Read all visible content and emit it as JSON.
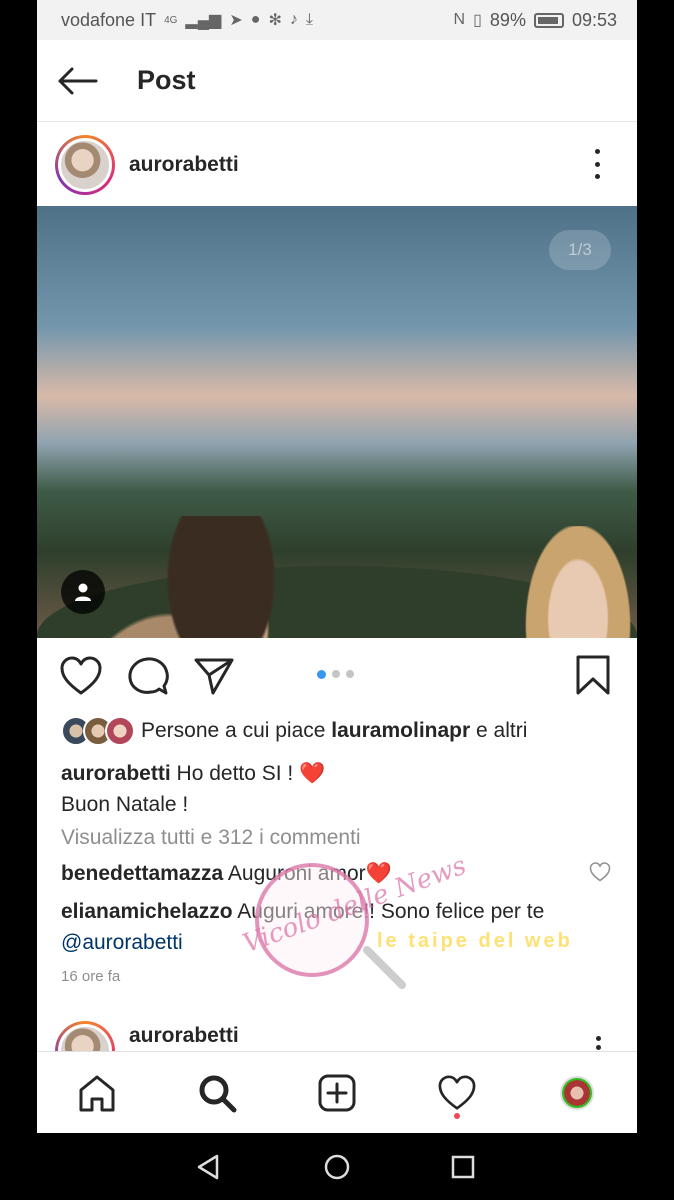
{
  "status_bar": {
    "carrier": "vodafone IT",
    "network": "4G",
    "battery_percent": "89%",
    "battery_level": 0.89,
    "time": "09:53",
    "icons": [
      "signal-icon",
      "telegram-icon",
      "facebook-icon",
      "settings-icon",
      "tiktok-icon",
      "download-icon",
      "nfc-icon",
      "vibrate-icon",
      "battery-icon"
    ]
  },
  "header": {
    "title": "Post"
  },
  "post": {
    "username": "aurorabetti",
    "photo_counter": "1/3",
    "carousel_total": 3,
    "carousel_active": 0,
    "likes": {
      "prefix": "Persone a cui piace",
      "user": "laura​molinapr",
      "suffix": "e altri"
    },
    "caption": {
      "user": "aurorabetti",
      "line1": "Ho detto SI !",
      "heart": "❤️",
      "line2": "Buon Natale !"
    },
    "view_all": "Visualizza tutti e 312 i commenti",
    "comments": [
      {
        "user": "benedettamazza",
        "text": "Auguroni amor",
        "emoji": "❤️"
      },
      {
        "user": "elianamichelazzo",
        "text": "Auguri amore!! Sono felice per te",
        "mention": "@aurorabetti"
      }
    ],
    "time": "16 ore fa"
  },
  "next_post": {
    "username": "aurorabetti"
  },
  "watermarks": {
    "left": "Vicolo delle News",
    "right": "le taipe del web"
  },
  "colors": {
    "accent_blue": "#3897f0",
    "notification_red": "#ed4956",
    "text_primary": "#262626",
    "text_secondary": "#8e8e8e"
  }
}
